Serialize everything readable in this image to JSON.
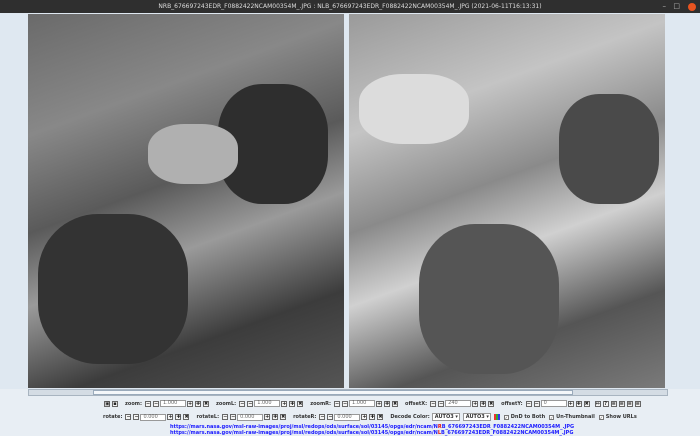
{
  "window": {
    "title": "NRB_676697243EDR_F0882422NCAM00354M_.JPG : NLB_676697243EDR_F0882422NCAM00354M_.JPG (2021-06-11T16:13:31)"
  },
  "toolbar": {
    "zoom": {
      "label": "zoom:",
      "value": "1.000"
    },
    "zoomL": {
      "label": "zoomL:",
      "value": "1.000"
    },
    "zoomR": {
      "label": "zoomR:",
      "value": "1.000"
    },
    "offsetX": {
      "label": "offsetX:",
      "value": "240"
    },
    "offsetY": {
      "label": "offsetY:",
      "value": "0"
    },
    "rotate": {
      "label": "rotate:",
      "value": "0.000"
    },
    "rotateL": {
      "label": "rotateL:",
      "value": "0.000"
    },
    "rotateR": {
      "label": "rotateR:",
      "value": "0.000"
    },
    "decode_label": "Decode Color:",
    "decodeL": "AUTO3",
    "decodeR": "AUTO3",
    "dnd_label": "DnD to Both",
    "unthumb_label": "Un-Thumbnail",
    "showurls_label": "Show URLs"
  },
  "urls": [
    {
      "pre": "https://mars.nasa.gov/msl-raw-images/proj/msl/redops/ods/surface/sol/03145/opgs/edr/ncam/N",
      "mark": "R",
      "post": "B_676697243EDR_F0882422NCAM00354M_.JPG"
    },
    {
      "pre": "https://mars.nasa.gov/msl-raw-images/proj/msl/redops/ods/surface/sol/03145/opgs/edr/ncam/N",
      "mark": "L",
      "post": "B_676697243EDR_F0882422NCAM00354M_.JPG"
    }
  ]
}
